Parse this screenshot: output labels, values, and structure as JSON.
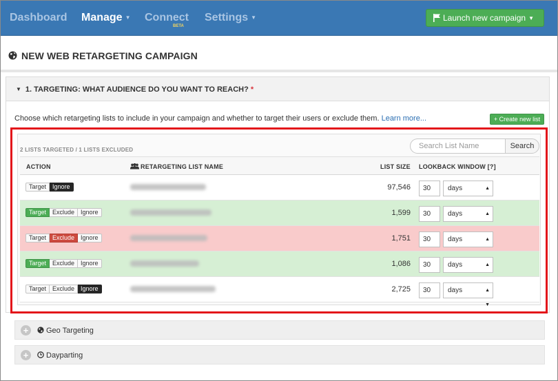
{
  "nav": {
    "items": [
      {
        "label": "Dashboard",
        "active": false,
        "caret": false
      },
      {
        "label": "Manage",
        "active": true,
        "caret": true
      },
      {
        "label": "Connect",
        "active": false,
        "caret": false
      },
      {
        "label": "Settings",
        "active": false,
        "caret": true
      }
    ],
    "beta_badge": "BETA",
    "launch_label": "Launch new campaign"
  },
  "page": {
    "title": "NEW WEB RETARGETING CAMPAIGN"
  },
  "targeting": {
    "title": "1.  TARGETING: WHAT AUDIENCE DO YOU WANT TO REACH?",
    "required_mark": "*",
    "intro": "Choose which retargeting lists to include in your campaign and whether to target their users or exclude them.",
    "learn_more": "Learn more...",
    "create_list": "+ Create new list",
    "summary": "2 LISTS TARGETED / 1 LISTS EXCLUDED",
    "search_placeholder": "Search List Name",
    "search_button": "Search",
    "columns": {
      "action": "ACTION",
      "name": "RETARGETING LIST NAME",
      "size": "LIST SIZE",
      "lookback": "LOOKBACK WINDOW [?]"
    },
    "rows": [
      {
        "state": "ignore",
        "options": [
          "Target",
          "Ignore"
        ],
        "size": "97,546",
        "window": "30",
        "unit": "days"
      },
      {
        "state": "target",
        "options": [
          "Target",
          "Exclude",
          "Ignore"
        ],
        "size": "1,599",
        "window": "30",
        "unit": "days"
      },
      {
        "state": "exclude",
        "options": [
          "Target",
          "Exclude",
          "Ignore"
        ],
        "size": "1,751",
        "window": "30",
        "unit": "days"
      },
      {
        "state": "target",
        "options": [
          "Target",
          "Exclude",
          "Ignore"
        ],
        "size": "1,086",
        "window": "30",
        "unit": "days"
      },
      {
        "state": "ignore",
        "options": [
          "Target",
          "Exclude",
          "Ignore"
        ],
        "size": "2,725",
        "window": "30",
        "unit": "days"
      }
    ]
  },
  "sections": [
    {
      "label": "Geo Targeting",
      "icon": "globe-icon"
    },
    {
      "label": "Dayparting",
      "icon": "clock-icon"
    }
  ],
  "colors": {
    "nav_bg": "#3a78b4",
    "launch_green": "#4cad55",
    "target_row": "#d6efd4",
    "exclude_row": "#f9cbcb",
    "exclude_red": "#cd4a3f",
    "highlight_red": "#e3141a"
  }
}
